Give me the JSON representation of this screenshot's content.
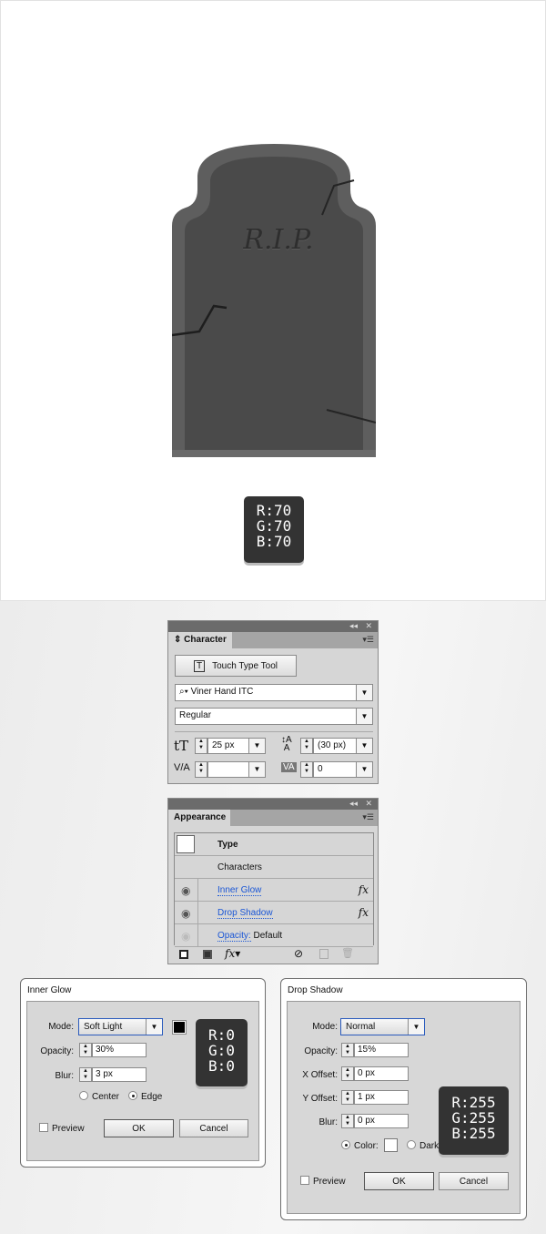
{
  "artwork": {
    "text": "R.I.P.",
    "color_swatch": {
      "r": "R:70",
      "g": "G:70",
      "b": "B:70",
      "hex": "#464646"
    }
  },
  "character_panel": {
    "tab": "Character",
    "touch_type_button": "Touch Type Tool",
    "font_family": "Viner Hand ITC",
    "font_style": "Regular",
    "font_size": "25 px",
    "leading": "(30 px)",
    "kerning": "",
    "tracking": "0"
  },
  "appearance_panel": {
    "tab": "Appearance",
    "type_label": "Type",
    "characters_label": "Characters",
    "effects": [
      {
        "name": "Inner Glow",
        "fx": "fx"
      },
      {
        "name": "Drop Shadow",
        "fx": "fx"
      }
    ],
    "opacity_label": "Opacity:",
    "opacity_value": "Default",
    "fx_button": "fx"
  },
  "inner_glow": {
    "title": "Inner Glow",
    "mode_label": "Mode:",
    "mode": "Soft Light",
    "opacity_label": "Opacity:",
    "opacity": "30%",
    "blur_label": "Blur:",
    "blur": "3 px",
    "center_label": "Center",
    "edge_label": "Edge",
    "selected": "Edge",
    "preview_label": "Preview",
    "ok": "OK",
    "cancel": "Cancel",
    "color": "#000000",
    "swatch": {
      "r": "R:0",
      "g": "G:0",
      "b": "B:0"
    }
  },
  "drop_shadow": {
    "title": "Drop Shadow",
    "mode_label": "Mode:",
    "mode": "Normal",
    "opacity_label": "Opacity:",
    "opacity": "15%",
    "x_label": "X Offset:",
    "x_offset": "0 px",
    "y_label": "Y Offset:",
    "y_offset": "1 px",
    "blur_label": "Blur:",
    "blur": "0 px",
    "color_label": "Color:",
    "darkness_label": "Dark",
    "selected": "Color",
    "preview_label": "Preview",
    "ok": "OK",
    "cancel": "Cancel",
    "color": "#ffffff",
    "swatch": {
      "r": "R:255",
      "g": "G:255",
      "b": "B:255"
    }
  }
}
